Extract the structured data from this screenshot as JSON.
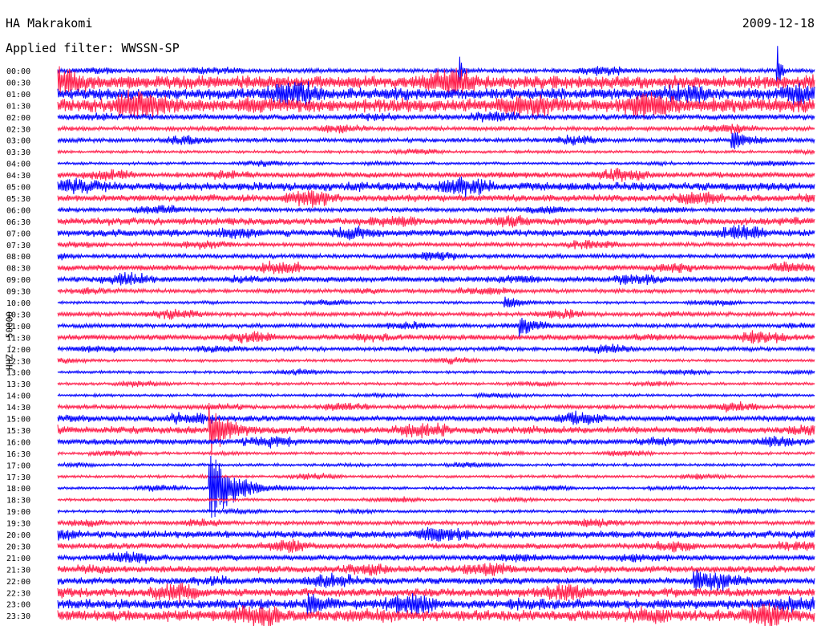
{
  "header": {
    "station": "HA Makrakomi",
    "date": "2009-12-18",
    "filter": "Applied filter: WWSSN-SP"
  },
  "chart_data": {
    "type": "line",
    "title": "HA Makrakomi",
    "ylabel": "HHZ - 50000",
    "tick_labels": [
      "00:00",
      "00:30",
      "01:00",
      "01:30",
      "02:00",
      "02:30",
      "03:00",
      "03:30",
      "04:00",
      "04:30",
      "05:00",
      "05:30",
      "06:00",
      "06:30",
      "07:00",
      "07:30",
      "08:00",
      "08:30",
      "09:00",
      "09:30",
      "10:00",
      "10:30",
      "11:00",
      "11:30",
      "12:00",
      "12:30",
      "13:00",
      "13:30",
      "14:00",
      "14:30",
      "15:00",
      "15:30",
      "16:00",
      "16:30",
      "17:00",
      "17:30",
      "18:00",
      "18:30",
      "19:00",
      "19:30",
      "20:00",
      "20:30",
      "21:00",
      "21:30",
      "22:00",
      "22:30",
      "23:00",
      "23:30"
    ],
    "series_colors": [
      "#0000ff",
      "#ff1e4b"
    ],
    "trace_amplitude": [
      3,
      9,
      8,
      10,
      4,
      3,
      3,
      2,
      2,
      4,
      6,
      5,
      3,
      5,
      5,
      3,
      3,
      4,
      4,
      3,
      2,
      3,
      3,
      4,
      3,
      2,
      2,
      2,
      2,
      3,
      4,
      5,
      4,
      2,
      2,
      2,
      2,
      2,
      2,
      3,
      5,
      4,
      4,
      5,
      5,
      6,
      7,
      8
    ],
    "events": [
      {
        "trace": 0,
        "t": 0.53,
        "amp": 30,
        "decay": 0.004
      },
      {
        "trace": 0,
        "t": 0.95,
        "amp": 45,
        "decay": 0.004
      },
      {
        "trace": 6,
        "t": 0.89,
        "amp": 16,
        "decay": 0.02
      },
      {
        "trace": 20,
        "t": 0.59,
        "amp": 14,
        "decay": 0.015
      },
      {
        "trace": 22,
        "t": 0.61,
        "amp": 12,
        "decay": 0.02
      },
      {
        "trace": 31,
        "t": 0.2,
        "amp": 40,
        "decay": 0.02
      },
      {
        "trace": 36,
        "t": 0.2,
        "amp": 60,
        "decay": 0.03
      },
      {
        "trace": 44,
        "t": 0.84,
        "amp": 14,
        "decay": 0.01
      },
      {
        "trace": 46,
        "t": 0.33,
        "amp": 18,
        "decay": 0.015
      }
    ]
  }
}
